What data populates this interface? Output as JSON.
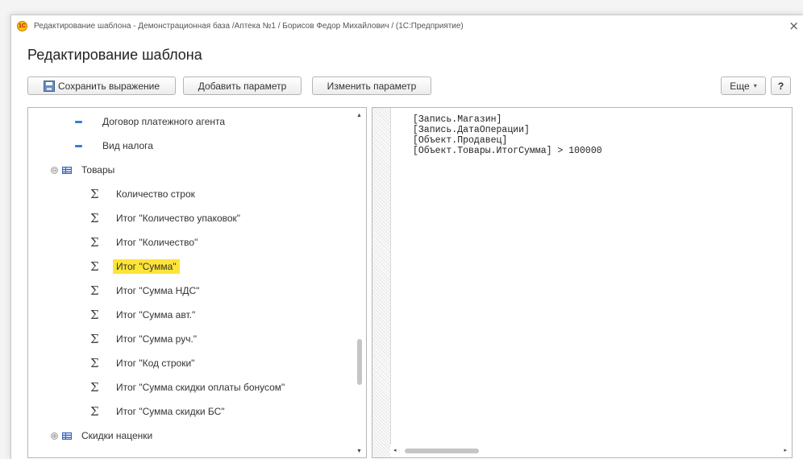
{
  "window": {
    "title": "Редактирование шаблона - Демонстрационная база /Аптека №1 / Борисов Федор Михайлович / (1С:Предприятие)",
    "close_glyph": "×",
    "logo_glyph": "1С"
  },
  "form": {
    "title": "Редактирование шаблона"
  },
  "toolbar": {
    "save_label": "Сохранить выражение",
    "add_param_label": "Добавить параметр",
    "change_param_label": "Изменить параметр",
    "more_label": "Еще",
    "more_caret": "▾",
    "help_label": "?"
  },
  "tree": {
    "items": [
      {
        "label": "Договор платежного агента",
        "icon": "dash-icon",
        "level": 2
      },
      {
        "label": "Вид налога",
        "icon": "dash-icon",
        "level": 2
      },
      {
        "label": "Товары",
        "icon": "table-icon",
        "level": 1,
        "expanded": true,
        "expander": "⊖"
      },
      {
        "label": "Количество строк",
        "icon": "sigma-icon",
        "level": 2
      },
      {
        "label": "Итог \"Количество упаковок\"",
        "icon": "sigma-icon",
        "level": 2
      },
      {
        "label": "Итог \"Количество\"",
        "icon": "sigma-icon",
        "level": 2
      },
      {
        "label": "Итог \"Сумма\"",
        "icon": "sigma-icon",
        "level": 2,
        "highlighted": true
      },
      {
        "label": "Итог \"Сумма НДС\"",
        "icon": "sigma-icon",
        "level": 2
      },
      {
        "label": "Итог \"Сумма авт.\"",
        "icon": "sigma-icon",
        "level": 2
      },
      {
        "label": "Итог \"Сумма руч.\"",
        "icon": "sigma-icon",
        "level": 2
      },
      {
        "label": "Итог \"Код строки\"",
        "icon": "sigma-icon",
        "level": 2
      },
      {
        "label": "Итог \"Сумма скидки оплаты бонусом\"",
        "icon": "sigma-icon",
        "level": 2
      },
      {
        "label": "Итог \"Сумма скидки БС\"",
        "icon": "sigma-icon",
        "level": 2
      },
      {
        "label": "Скидки наценки",
        "icon": "table-icon",
        "level": 1,
        "expanded": false,
        "expander": "⊕"
      }
    ],
    "sigma_glyph": "Σ",
    "scroll": {
      "up": "▲",
      "down": "▼",
      "position": 0.78,
      "visible_fraction": 0.14
    }
  },
  "editor": {
    "lines": [
      "[Запись.Магазин]",
      "[Запись.ДатаОперации]",
      "[Объект.Продавец]",
      "[Объект.Товары.ИтогСумма] > 100000"
    ],
    "hscroll": {
      "left": "◂",
      "right": "▸",
      "position": 0.0,
      "visible_fraction": 0.2
    }
  },
  "colors": {
    "highlight": "#fde438",
    "accent_icon": "#3a7bd5"
  }
}
